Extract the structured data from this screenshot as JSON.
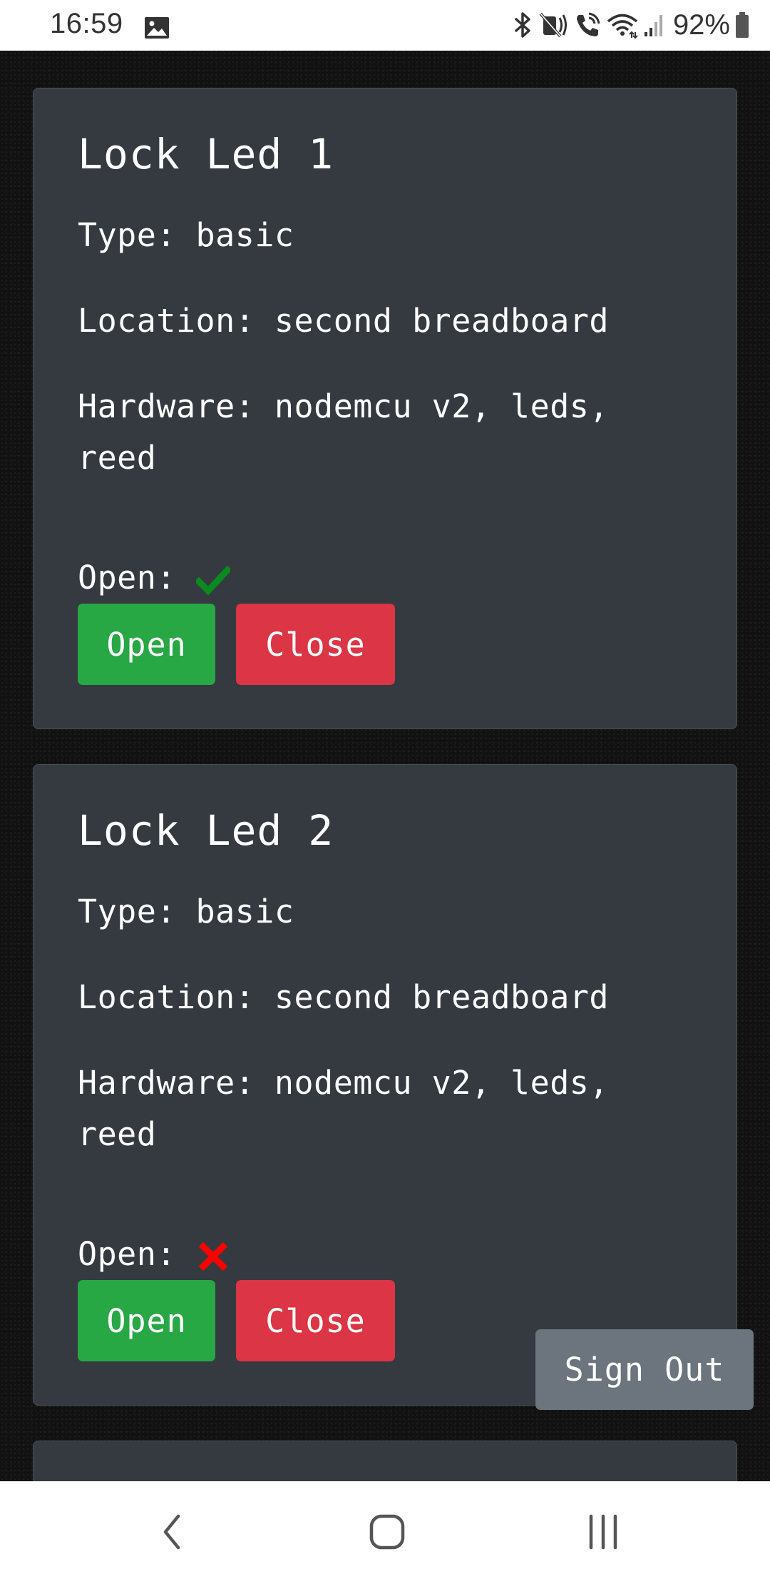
{
  "status_bar": {
    "time": "16:59",
    "battery_percent": "92%",
    "icons": [
      "gallery-icon",
      "bluetooth-icon",
      "mute-icon",
      "wifi-calling-icon",
      "wifi-icon",
      "signal-icon",
      "battery-icon"
    ]
  },
  "devices": [
    {
      "title": "Lock Led 1",
      "type": "Type: basic",
      "location": "Location: second breadboard",
      "hardware": "Hardware: nodemcu v2, leds, reed",
      "open_label": "Open:",
      "open_state": "check-icon",
      "open_color": "#0a8a1f",
      "open_button": "Open",
      "close_button": "Close"
    },
    {
      "title": "Lock Led 2",
      "type": "Type: basic",
      "location": "Location: second breadboard",
      "hardware": "Hardware: nodemcu v2, leds, reed",
      "open_label": "Open:",
      "open_state": "cross-icon",
      "open_color": "#ff0000",
      "open_button": "Open",
      "close_button": "Close"
    }
  ],
  "signout_label": "Sign Out",
  "colors": {
    "card": "#343a40",
    "open_button": "#28a745",
    "close_button": "#dc3545",
    "signout_button": "#6c757d"
  },
  "nav_bar": {
    "icons": [
      "back-icon",
      "home-icon",
      "recent-apps-icon"
    ]
  }
}
